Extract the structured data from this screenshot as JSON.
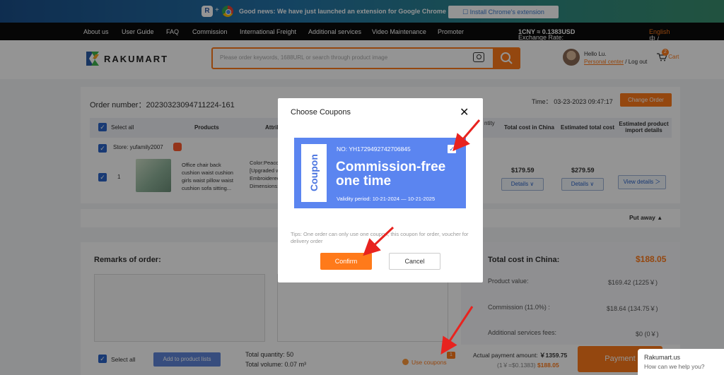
{
  "banner": {
    "text": "Good news: We have just launched an extension for Google Chrome",
    "button": "Install Chrome's extension"
  },
  "nav": {
    "items": [
      "About us",
      "User Guide",
      "FAQ",
      "Commission",
      "International Freight",
      "Additional services",
      "Video Maintenance",
      "Promoter"
    ],
    "rate_label": "Exchange Rate:",
    "rate_value": "1CNY ≈ 0.1383USD",
    "lang_cn": "中 /",
    "lang_en": "English"
  },
  "header": {
    "brand": "RAKUMART",
    "search_placeholder": "Please order keywords, 1688URL or search through product image",
    "greeting": "Hello Lu.",
    "personal_center": "Personal center",
    "logout": "/ Log out",
    "cart_label": "Cart",
    "cart_count": "2"
  },
  "order": {
    "number_label": "Order number：",
    "number": "20230323094711224-161",
    "time_label": "Time：",
    "time": "03-23-2023 09:47:17",
    "change_button": "Change Order",
    "columns": [
      "Select all",
      "Products",
      "Attrib",
      "ntity",
      "Total cost in China",
      "Estimated total cost",
      "Estimated product import details"
    ],
    "store_label": "Store:",
    "store_name": "yufamily2007",
    "row": {
      "index": "1",
      "desc": "Office chair back cushion waist cushion girls waist pillow waist cushion sofa sitting...",
      "attrs": [
        "Color:Peaco",
        "[Upgraded w",
        "Embroiderec",
        "Dimensions:"
      ],
      "total_china": "$179.59",
      "estimated_total": "$279.59",
      "details1": "Details ∨",
      "details2": "Details ∨",
      "view_details": "View details ＞"
    },
    "put_away": "Put away"
  },
  "remarks": {
    "title": "Remarks of order:"
  },
  "summary": {
    "title": "Total cost in China:",
    "total": "$188.05",
    "rows": [
      {
        "label": "Product value:",
        "value": "$169.42  (1225￥)"
      },
      {
        "label": "Commission  (11.0%) :",
        "value": "$18.64  (134.75￥)"
      },
      {
        "label": "Additional services fees:",
        "value": "$0  (0￥)"
      }
    ]
  },
  "bottom": {
    "select_all": "Select all",
    "add_to_list": "Add to product lists",
    "total_qty_label": "Total quantity:",
    "total_qty": "50",
    "total_vol_label": "Total volume:",
    "total_vol": "0.07 m³",
    "use_coupons": "Use coupons",
    "coupon_badge": "1",
    "pay_label": "Actual payment amount:",
    "pay_value": "￥1359.75",
    "pay_sub": "(1￥=$0.1383)",
    "pay_usd": "$188.05",
    "payment_button": "Payment"
  },
  "chat": {
    "title": "Rakumart.us",
    "subtitle": "How can we help you?"
  },
  "modal": {
    "title": "Choose Coupons",
    "coupon_tab": "Coupon",
    "coupon_no": "NO:  YH1729492742706845",
    "coupon_title": "Commission-free one time",
    "validity": "Validity period:  10-21-2024 — 10-21-2025",
    "tips": "Tips: One order can only use one coupon, this coupon for order, voucher for delivery order",
    "confirm": "Confirm",
    "cancel": "Cancel"
  },
  "colors": {
    "accent": "#ff7a1a",
    "blue": "#2b64c8",
    "coupon": "#5b85f0",
    "arrow": "#e8231f"
  }
}
